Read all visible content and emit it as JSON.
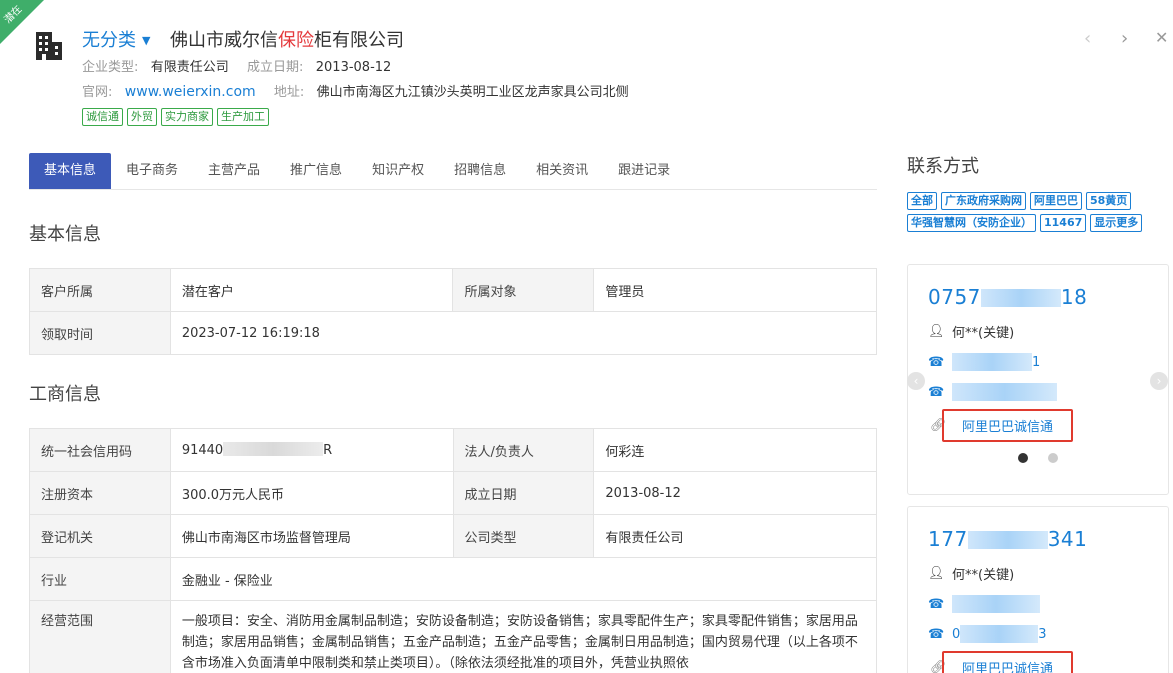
{
  "ribbon": "潜在",
  "header": {
    "category": "无分类",
    "company_name_pre": "佛山市威尔信",
    "company_name_hl": "保险",
    "company_name_post": "柜有限公司",
    "type_label": "企业类型:",
    "type_value": "有限责任公司",
    "founded_label": "成立日期:",
    "founded_value": "2013-08-12",
    "site_label": "官网:",
    "site_value": "www.weierxin.com",
    "addr_label": "地址:",
    "addr_value": "佛山市南海区九江镇沙头英明工业区龙声家具公司北侧",
    "tags": [
      "诚信通",
      "外贸",
      "实力商家",
      "生产加工"
    ]
  },
  "tabs": [
    "基本信息",
    "电子商务",
    "主营产品",
    "推广信息",
    "知识产权",
    "招聘信息",
    "相关资讯",
    "跟进记录"
  ],
  "basic": {
    "title": "基本信息",
    "owner_label": "客户所属",
    "owner_value": "潜在客户",
    "target_label": "所属对象",
    "target_value": "管理员",
    "claim_label": "领取时间",
    "claim_value": "2023-07-12 16:19:18"
  },
  "biz": {
    "title": "工商信息",
    "credit_label": "统一社会信用码",
    "credit_pre": "91440",
    "credit_post": "R",
    "legal_label": "法人/负责人",
    "legal_value": "何彩连",
    "capital_label": "注册资本",
    "capital_value": "300.0万元人民币",
    "founded_label": "成立日期",
    "founded_value": "2013-08-12",
    "reg_label": "登记机关",
    "reg_value": "佛山市南海区市场监督管理局",
    "ctype_label": "公司类型",
    "ctype_value": "有限责任公司",
    "industry_label": "行业",
    "industry_value": "金融业 - 保险业",
    "scope_label": "经营范围",
    "scope_value": "一般项目：安全、消防用金属制品制造；安防设备制造；安防设备销售；家具零配件生产；家具零配件销售；家居用品制造；家居用品销售；金属制品销售；五金产品制造；五金产品零售；金属制日用品制造；国内贸易代理（以上各项不含市场准入负面清单中限制类和禁止类项目）。（除依法须经批准的项目外，凭营业执照依"
  },
  "contact": {
    "title": "联系方式",
    "sources": [
      "全部",
      "广东政府采购网",
      "阿里巴巴",
      "58黄页",
      "华强智慧网（安防企业）",
      "11467",
      "显示更多"
    ],
    "cards": [
      {
        "phone_pre": "0757",
        "phone_post": "18",
        "person": "何**(关键)",
        "phone2_post": "1",
        "link": "阿里巴巴诚信通"
      },
      {
        "phone_pre": "177",
        "phone_post": "341",
        "person": "何**(关键)",
        "phone3_pre": "0",
        "phone3_post": "3",
        "link": "阿里巴巴诚信通"
      }
    ]
  },
  "colors": {
    "accent": "#1a7fd4",
    "tab_active": "#3d5ab8",
    "tag_green": "#3aaa4a",
    "highlight_red": "#e03a2e"
  }
}
